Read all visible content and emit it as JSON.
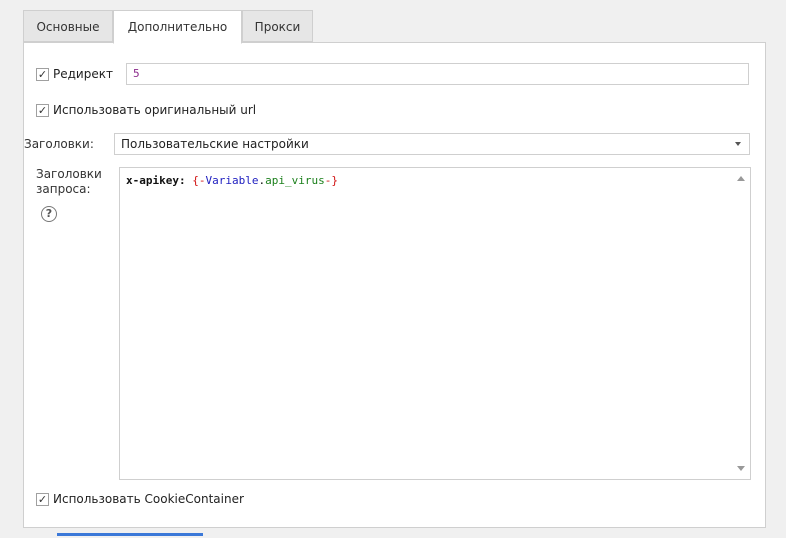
{
  "tabs": [
    {
      "label": "Основные"
    },
    {
      "label": "Дополнительно"
    },
    {
      "label": "Прокси"
    }
  ],
  "redirect": {
    "label": "Редирект",
    "value": "5",
    "checked": true
  },
  "use_original_url": {
    "label": "Использовать оригинальный url",
    "checked": true
  },
  "headers": {
    "label": "Заголовки:",
    "selected": "Пользовательские настройки"
  },
  "request_headers": {
    "label_line1": "Заголовки",
    "label_line2": "запроса:",
    "code": {
      "key": "x-apikey: ",
      "open": "{-",
      "var": "Variable",
      "dot": ".",
      "prop": "api_virus",
      "close": "-}"
    }
  },
  "cookie_container": {
    "label": "Использовать CookieContainer",
    "checked": true
  },
  "colors": {
    "accent": "#3b78d8"
  }
}
